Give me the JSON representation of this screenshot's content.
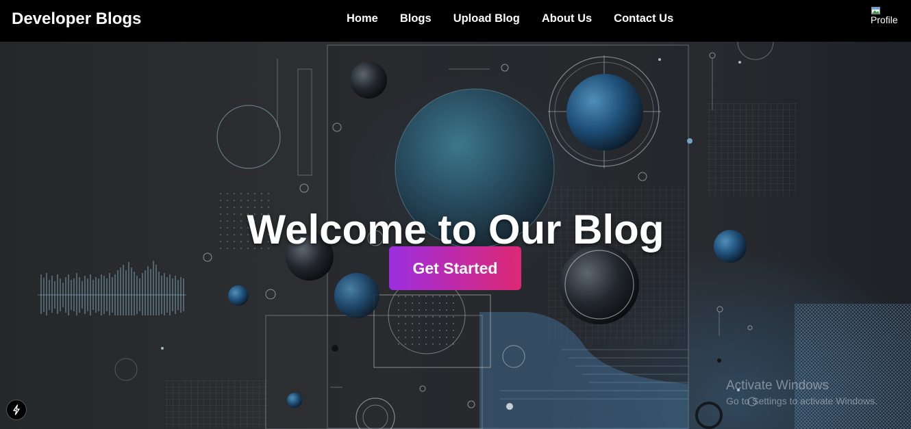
{
  "navbar": {
    "brand": "Developer Blogs",
    "links": [
      "Home",
      "Blogs",
      "Upload Blog",
      "About Us",
      "Contact Us"
    ],
    "profile_alt": "Profile"
  },
  "hero": {
    "title": "Welcome to Our Blog",
    "cta_label": "Get Started"
  },
  "overlay": {
    "watermark_line1": "Activate Windows",
    "watermark_line2": "Go to Settings to activate Windows.",
    "dev_indicator_icon": "lightning-icon"
  },
  "colors": {
    "navbar_bg": "#000000",
    "cta_gradient_start": "#9b2ee0",
    "cta_gradient_end": "#dd2874",
    "text": "#ffffff"
  }
}
